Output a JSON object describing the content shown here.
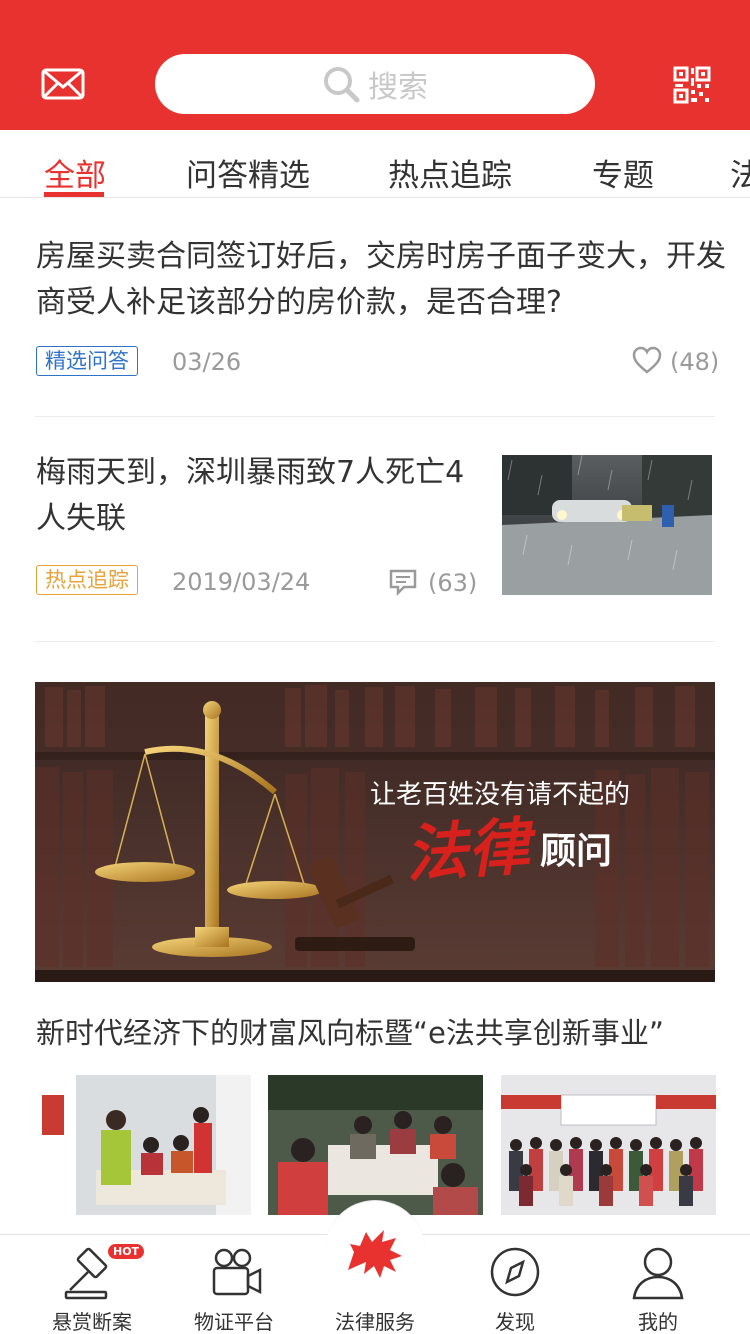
{
  "header": {
    "search_placeholder": "搜索",
    "mail_icon": "mail-icon",
    "qr_icon": "qr-code-icon"
  },
  "tabs": [
    {
      "label": "全部",
      "active": true
    },
    {
      "label": "问答精选",
      "active": false
    },
    {
      "label": "热点追踪",
      "active": false
    },
    {
      "label": "专题",
      "active": false
    },
    {
      "label": "法",
      "active": false
    }
  ],
  "articles": [
    {
      "title": "房屋买卖合同签订好后，交房时房子面子变大，开发商受人补足该部分的房价款，是否合理?",
      "tag": "精选问答",
      "date": "03/26",
      "likes": "(48)"
    },
    {
      "title": "梅雨天到，深圳暴雨致7人死亡4人失联",
      "tag": "热点追踪",
      "date": "2019/03/24",
      "comments": "(63)"
    }
  ],
  "banner": {
    "line1": "让老百姓没有请不起的",
    "script": "法律",
    "line2": "顾问"
  },
  "feature": {
    "title": "新时代经济下的财富风向标暨“e法共享创新事业”"
  },
  "bottom_nav": [
    {
      "label": "悬赏断案",
      "badge": "HOT"
    },
    {
      "label": "物证平台"
    },
    {
      "label": "法律服务"
    },
    {
      "label": "发现"
    },
    {
      "label": "我的"
    }
  ],
  "colors": {
    "accent": "#e8322f",
    "blue_tag": "#2f73c9",
    "orange_tag": "#e8a23a"
  }
}
